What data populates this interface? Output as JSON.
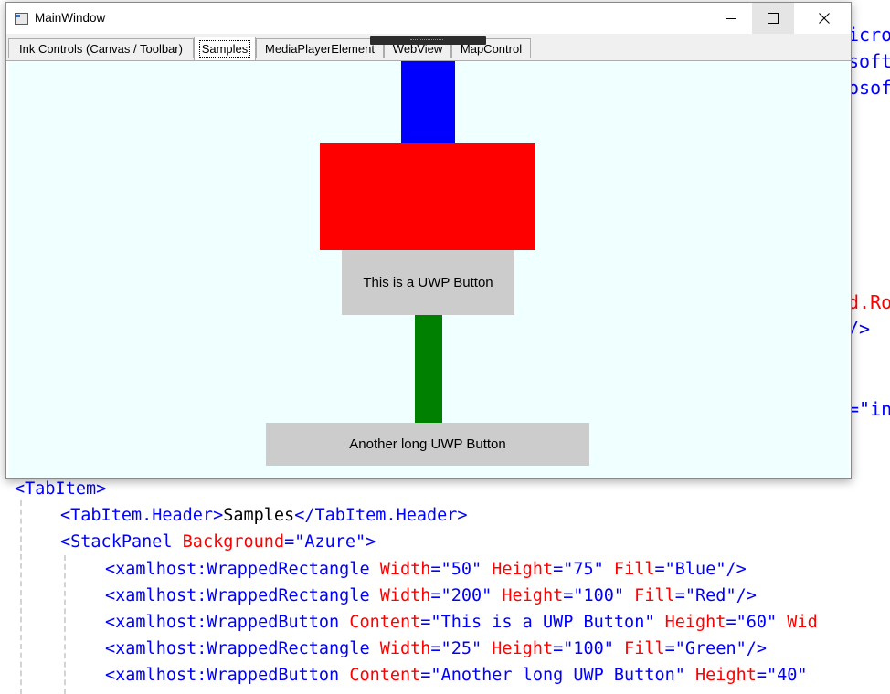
{
  "window": {
    "title": "MainWindow",
    "controls": {
      "minimize": "minimize",
      "maximize": "maximize",
      "close": "close"
    }
  },
  "tabs": [
    {
      "label": "Ink Controls (Canvas / Toolbar)",
      "selected": false
    },
    {
      "label": "Samples",
      "selected": true
    },
    {
      "label": "MediaPlayerElement",
      "selected": false
    },
    {
      "label": "WebView",
      "selected": false
    },
    {
      "label": "MapControl",
      "selected": false
    }
  ],
  "samples_panel": {
    "background": "Azure",
    "blue_rect": {
      "fill": "#0000ff"
    },
    "red_rect": {
      "fill": "#ff0000"
    },
    "button1": {
      "label": "This is a UWP Button"
    },
    "green_rect": {
      "fill": "#008000"
    },
    "button2": {
      "label": "Another long UWP Button"
    }
  },
  "code_editor": {
    "right_fragments": [
      "icro",
      "soft",
      "osof",
      "d.Ro",
      "/>",
      "=\"in"
    ],
    "lines": [
      {
        "tag_open": "<",
        "tag": "TabItem",
        "tag_close": ">"
      },
      {
        "part1": "<TabItem.Header>",
        "text": "Samples",
        "part2": "</TabItem.Header>"
      },
      {
        "tag": "<StackPanel",
        "attr": " Background",
        "eq": "=",
        "val": "\"Azure\"",
        "end": ">"
      },
      {
        "tag": "<xamlhost:WrappedRectangle",
        "a1": " Width",
        "v1": "=\"50\"",
        "a2": " Height",
        "v2": "=\"75\"",
        "a3": " Fill",
        "v3": "=\"Blue\"/>"
      },
      {
        "tag": "<xamlhost:WrappedRectangle",
        "a1": " Width",
        "v1": "=\"200\"",
        "a2": " Height",
        "v2": "=\"100\"",
        "a3": " Fill",
        "v3": "=\"Red\"/>"
      },
      {
        "tag": "<xamlhost:WrappedButton",
        "a1": " Content",
        "v1": "=\"This is a UWP Button\"",
        "a2": " Height",
        "v2": "=\"60\"",
        "a3": " Wid"
      },
      {
        "tag": "<xamlhost:WrappedRectangle",
        "a1": " Width",
        "v1": "=\"25\"",
        "a2": " Height",
        "v2": "=\"100\"",
        "a3": " Fill",
        "v3": "=\"Green\"/>"
      },
      {
        "tag": "<xamlhost:WrappedButton",
        "a1": " Content",
        "v1": "=\"Another long UWP Button\"",
        "a2": " Height",
        "v2": "=\"40\""
      }
    ]
  }
}
